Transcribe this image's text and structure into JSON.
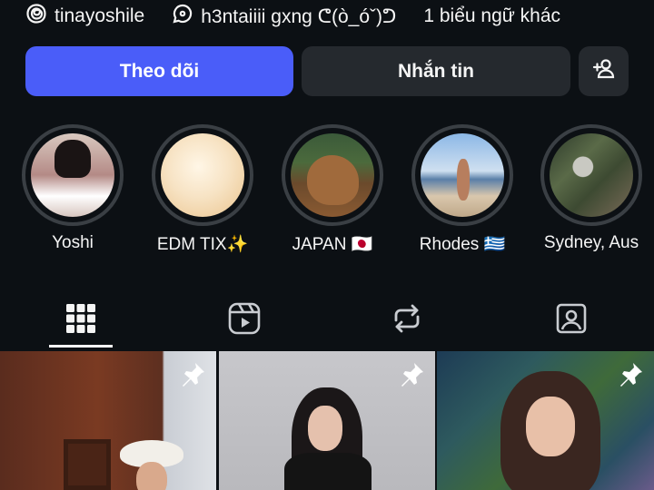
{
  "profile_links": {
    "threads_handle": "tinayoshile",
    "threads_icon": "threads-icon",
    "chat_text": "h3ntaiiii gxng ᕦ(ò_óˇ)ᕤ",
    "chat_icon": "chat-bubble-icon",
    "more_text": "1 biểu ngữ khác"
  },
  "buttons": {
    "follow": "Theo dõi",
    "message": "Nhắn tin",
    "add_person_icon": "add-person-icon"
  },
  "highlights": [
    {
      "label": "Yoshi"
    },
    {
      "label": "EDM TIX✨"
    },
    {
      "label": "JAPAN 🇯🇵"
    },
    {
      "label": "Rhodes 🇬🇷"
    },
    {
      "label": "Sydney, Aus"
    }
  ],
  "tabs": [
    {
      "icon": "grid-icon",
      "active": true
    },
    {
      "icon": "reels-icon",
      "active": false
    },
    {
      "icon": "repost-icon",
      "active": false
    },
    {
      "icon": "tagged-icon",
      "active": false
    }
  ],
  "grid_posts": [
    {
      "pinned": true
    },
    {
      "pinned": true
    },
    {
      "pinned": true
    }
  ],
  "colors": {
    "background": "#0c1014",
    "follow_button": "#4a5df9",
    "secondary_button": "#25292e",
    "text": "#f5f5f5"
  }
}
